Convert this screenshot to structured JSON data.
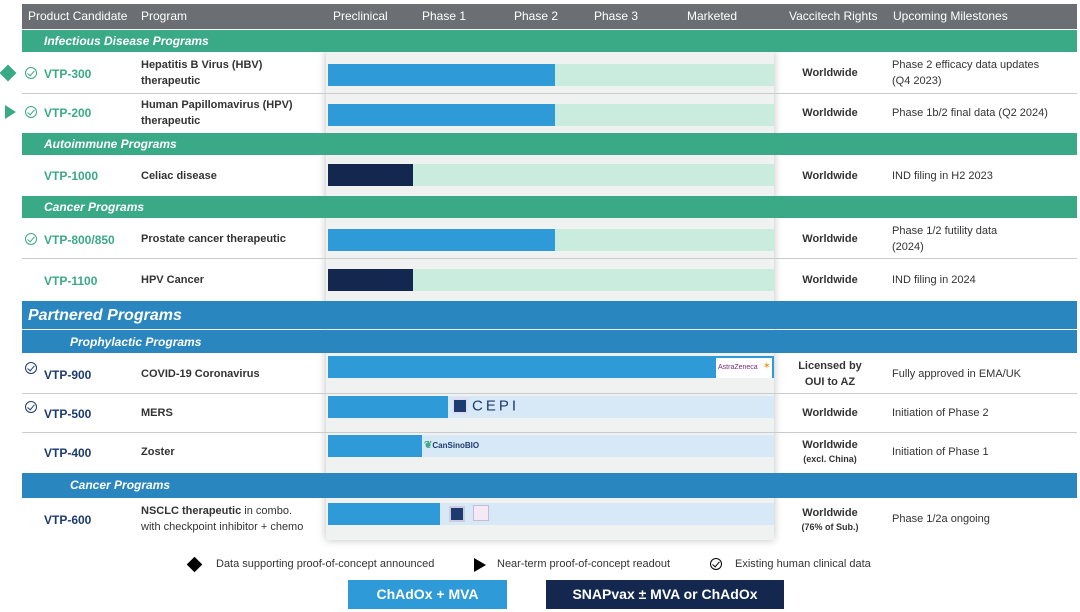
{
  "header": {
    "product_candidate": "Product Candidate",
    "program": "Program",
    "preclinical": "Preclinical",
    "phase1": "Phase 1",
    "phase2": "Phase 2",
    "phase3": "Phase 3",
    "marketed": "Marketed",
    "rights": "Vaccitech Rights",
    "milestones": "Upcoming Milestones"
  },
  "sections": {
    "infectious": "Infectious Disease Programs",
    "autoimmune": "Autoimmune Programs",
    "cancer": "Cancer Programs",
    "partnered": "Partnered Programs",
    "prophylactic": "Prophylactic Programs",
    "partner_cancer": "Cancer Programs"
  },
  "rows": [
    {
      "code": "VTP-300",
      "program_l1": "Hepatitis B Virus (HBV)",
      "program_l2": "therapeutic",
      "rights": "Worldwide",
      "milestone_l1": "Phase 2 efficacy data updates",
      "milestone_l2": "(Q4 2023)",
      "progress": 0.51,
      "marker": "diamond",
      "checked": true
    },
    {
      "code": "VTP-200",
      "program_l1": "Human Papillomavirus (HPV)",
      "program_l2": "therapeutic",
      "rights": "Worldwide",
      "milestone_l1": "Phase 1b/2 final data (Q2 2024)",
      "milestone_l2": "",
      "progress": 0.51,
      "marker": "triangle",
      "checked": true
    },
    {
      "code": "VTP-1000",
      "program_l1": "Celiac disease",
      "program_l2": "",
      "rights": "Worldwide",
      "milestone_l1": "IND filing in H2 2023",
      "milestone_l2": "",
      "progress": 0.19,
      "marker": "",
      "checked": false
    },
    {
      "code": "VTP-800/850",
      "program_l1": "Prostate cancer therapeutic",
      "program_l2": "",
      "rights": "Worldwide",
      "milestone_l1": "Phase 1/2 futility data",
      "milestone_l2": "(2024)",
      "progress": 0.51,
      "marker": "",
      "checked": true
    },
    {
      "code": "VTP-1100",
      "program_l1": "HPV Cancer",
      "program_l2": "",
      "rights": "Worldwide",
      "milestone_l1": "IND filing in 2024",
      "milestone_l2": "",
      "progress": 0.19,
      "marker": "",
      "checked": false
    },
    {
      "code": "VTP-900",
      "program_l1": "COVID-19 Coronavirus",
      "program_l2": "",
      "rights_l1": "Licensed by",
      "rights_l2": "OUI to AZ",
      "milestone_l1": "Fully approved in EMA/UK",
      "milestone_l2": "",
      "progress": 1.0,
      "checked": true
    },
    {
      "code": "VTP-500",
      "program_l1": "MERS",
      "program_l2": "",
      "rights": "Worldwide",
      "milestone_l1": "Initiation of Phase 2",
      "milestone_l2": "",
      "progress": 0.27,
      "checked": true
    },
    {
      "code": "VTP-400",
      "program_l1": "Zoster",
      "program_l2": "",
      "rights": "Worldwide",
      "rights_sub": "(excl. China)",
      "milestone_l1": "Initiation of Phase 1",
      "milestone_l2": "",
      "progress": 0.21,
      "checked": false
    },
    {
      "code": "VTP-600",
      "program_l1": "NSCLC therapeutic",
      "program_l1_rest": " in combo.",
      "program_l2": "with checkpoint inhibitor + chemo",
      "rights": "Worldwide",
      "rights_sub": "(76% of Sub.)",
      "milestone_l1": "Phase 1/2a ongoing",
      "milestone_l2": "",
      "progress": 0.25,
      "checked": false
    }
  ],
  "partner_logos": {
    "astrazeneca": "AstraZeneca",
    "cepi": "CEPI",
    "cansino": "CanSinoBIO"
  },
  "legend": {
    "diamond": "Data supporting proof-of-concept announced",
    "triangle": "Near-term proof-of-concept readout",
    "check": "Existing human clinical data"
  },
  "key": {
    "chadox": "ChAdOx + MVA",
    "snapvax": "SNAPvax ± MVA or ChAdOx"
  },
  "colors": {
    "green": "#3aa986",
    "blue": "#2a86bf",
    "sky": "#2f9ad8",
    "navy": "#13274f",
    "header": "#6b6f73"
  }
}
